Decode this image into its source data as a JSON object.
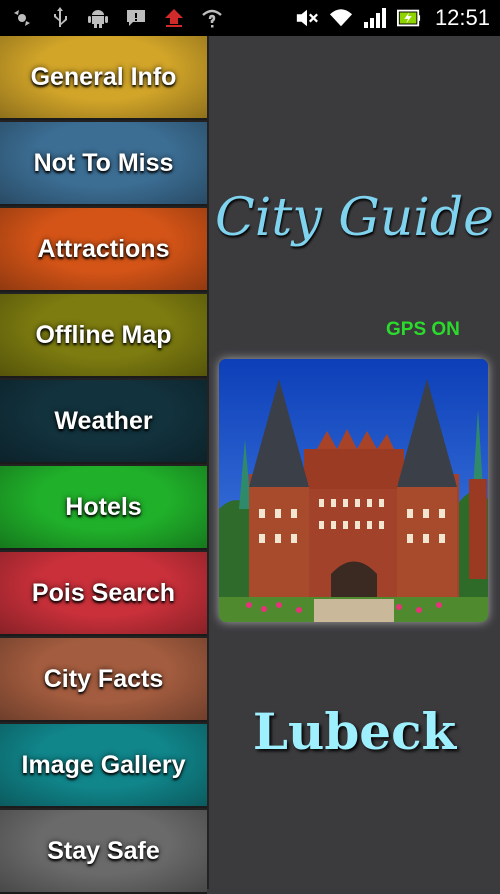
{
  "status_bar": {
    "left_icons": [
      "gps-icon",
      "usb-icon",
      "android-icon",
      "sms-icon",
      "upload-icon",
      "wifi-question-icon"
    ],
    "right_icons": [
      "mute-icon",
      "wifi-icon",
      "signal-icon",
      "battery-charging-icon"
    ],
    "time": "12:51"
  },
  "menu": {
    "items": [
      {
        "label": "General Info",
        "color": "#d2a529"
      },
      {
        "label": "Not To Miss",
        "color": "#3c6e94"
      },
      {
        "label": "Attractions",
        "color": "#d45417"
      },
      {
        "label": "Offline Map",
        "color": "#7d7c10"
      },
      {
        "label": "Weather",
        "color": "#12323d"
      },
      {
        "label": "Hotels",
        "color": "#20b02a"
      },
      {
        "label": "Pois Search",
        "color": "#c9303a"
      },
      {
        "label": "City Facts",
        "color": "#a35c3f"
      },
      {
        "label": "Image Gallery",
        "color": "#10858a"
      },
      {
        "label": "Stay Safe",
        "color": "#6a6a6a"
      }
    ]
  },
  "main": {
    "title": "City Guide",
    "gps_status": "GPS ON",
    "city_name": "Lubeck"
  },
  "colors": {
    "title": "#7fd3ee",
    "gps": "#2bdb2b",
    "city": "#9ff0ff",
    "background": "#3b3b3e"
  }
}
